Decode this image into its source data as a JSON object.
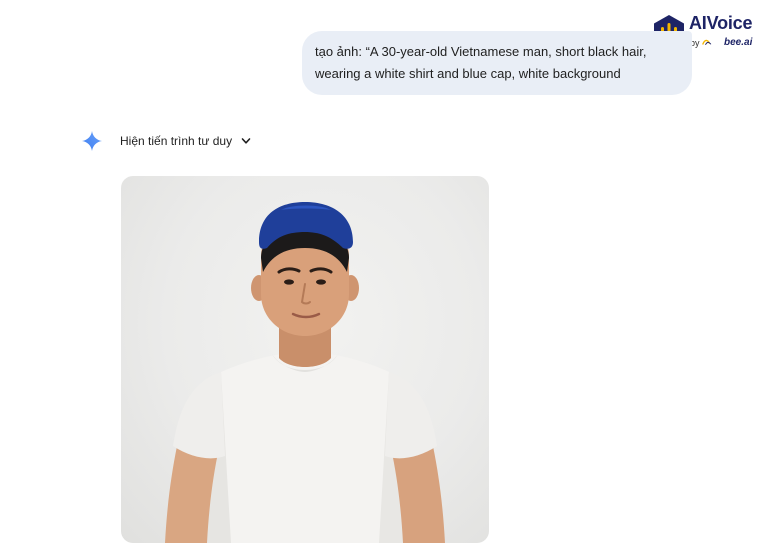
{
  "logo": {
    "brand": "AIVoice",
    "by": "by",
    "partner": "bee.ai",
    "icon": "waveform-hexagon-icon"
  },
  "colors": {
    "bubble_bg": "#e9eef6",
    "accent_blue": "#4b8ff5",
    "brand_navy": "#1e2466",
    "brand_yellow": "#f5b700"
  },
  "chat": {
    "user_message_line1": "tạo ảnh: “A 30-year-old Vietnamese man, short black hair,",
    "user_message_line2": "wearing a white shirt and blue cap, white background",
    "thinking_toggle_label": "Hiện tiến trình tư duy",
    "thinking_toggle_icon": "chevron-down-icon",
    "assistant_icon": "gemini-sparkle-icon"
  }
}
